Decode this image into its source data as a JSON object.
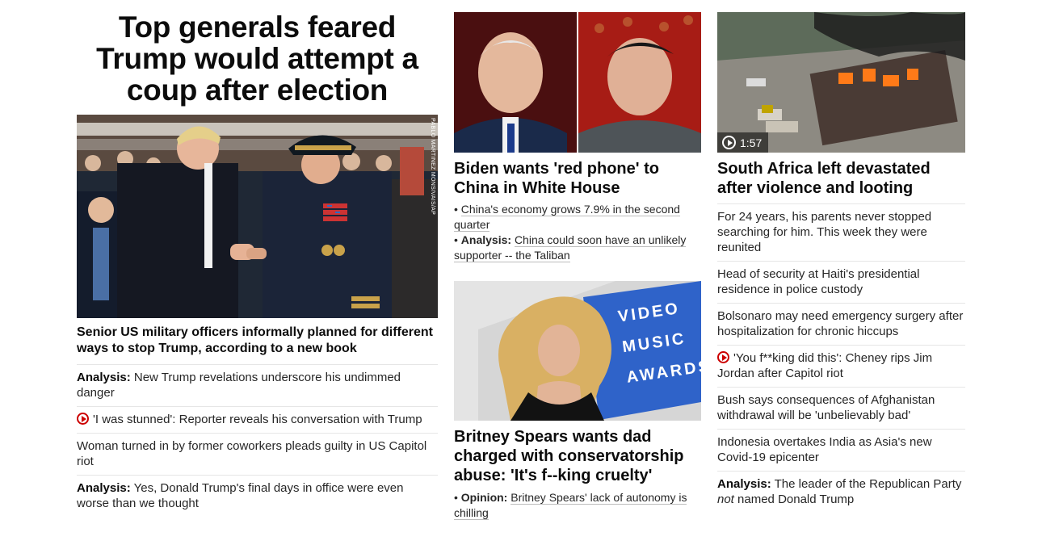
{
  "col1": {
    "hero_title": "Top generals feared Trump would attempt a coup after election",
    "photo_credit": "PABLO MARTINEZ MONSIVAIS/AP",
    "lead": "Senior US military officers informally planned for different ways to stop Trump, according to a new book",
    "items": [
      {
        "label": "Analysis:",
        "text": "New Trump revelations underscore his undimmed danger"
      },
      {
        "video": true,
        "text": "'I was stunned': Reporter reveals his conversation with Trump"
      },
      {
        "text": "Woman turned in by former coworkers pleads guilty in US Capitol riot"
      },
      {
        "label": "Analysis:",
        "text": "Yes, Donald Trump's final days in office were even worse than we thought"
      }
    ]
  },
  "col2": {
    "story1": {
      "headline": "Biden wants 'red phone' to China in White House",
      "bullets": [
        {
          "text": "China's economy grows 7.9% in the second quarter"
        },
        {
          "label": "Analysis:",
          "text": "China could soon have an unlikely supporter -- the Taliban"
        }
      ]
    },
    "story2": {
      "sign_lines": [
        "VIDEO",
        "MUSIC",
        "AWARDS"
      ],
      "headline": "Britney Spears wants dad charged with conservatorship abuse: 'It's f--king cruelty'",
      "bullets": [
        {
          "label": "Opinion:",
          "text": "Britney Spears' lack of autonomy is chilling"
        }
      ]
    }
  },
  "col3": {
    "video_duration": "1:57",
    "headline": "South Africa left devastated after violence and looting",
    "items": [
      {
        "text": "For 24 years, his parents never stopped searching for him. This week they were reunited"
      },
      {
        "text": "Head of security at Haiti's presidential residence in police custody"
      },
      {
        "text": "Bolsonaro may need emergency surgery after hospitalization for chronic hiccups"
      },
      {
        "video": true,
        "text": "'You f**king did this': Cheney rips Jim Jordan after Capitol riot"
      },
      {
        "text": "Bush says consequences of Afghanistan withdrawal will be 'unbelievably bad'"
      },
      {
        "text": "Indonesia overtakes India as Asia's new Covid-19 epicenter"
      },
      {
        "label": "Analysis:",
        "text": "The leader of the Republican Party",
        "emph": "not",
        "text_after": "named Donald Trump"
      }
    ]
  },
  "colors": {
    "video_red": "#cc0000",
    "divider": "#e6e6e6"
  }
}
